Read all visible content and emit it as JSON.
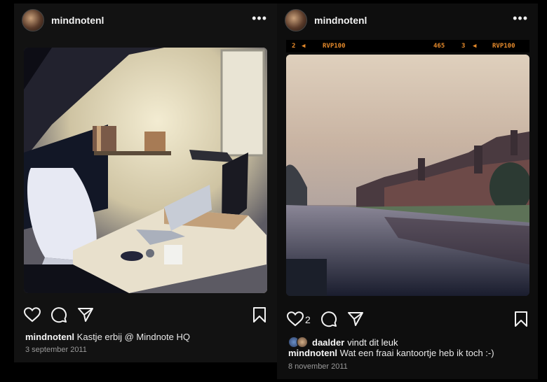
{
  "posts": [
    {
      "username": "mindnotenl",
      "caption_user": "mindnotenl",
      "caption_text": "Kastje erbij @ Mindnote HQ",
      "date": "3 september 2011"
    },
    {
      "username": "mindnotenl",
      "like_count": "2",
      "liked_by_user": "daalder",
      "liked_by_text": "vindt dit leuk",
      "caption_user": "mindnotenl",
      "caption_text": "Wat een fraai kantoortje heb ik toch :-)",
      "date": "8 november 2011",
      "filmstrip": {
        "left_frame": "2",
        "left_code": "RVP100",
        "mid_number": "465",
        "right_frame": "3",
        "right_code": "RVP100"
      }
    }
  ],
  "icons": [
    "more-options-icon",
    "heart-icon",
    "comment-icon",
    "share-icon",
    "bookmark-icon"
  ],
  "colors": {
    "background": "#000000",
    "card": "#121212",
    "text": "#f5f5f5",
    "muted": "#9a9a9a",
    "film_orange": "#e58a2b"
  }
}
